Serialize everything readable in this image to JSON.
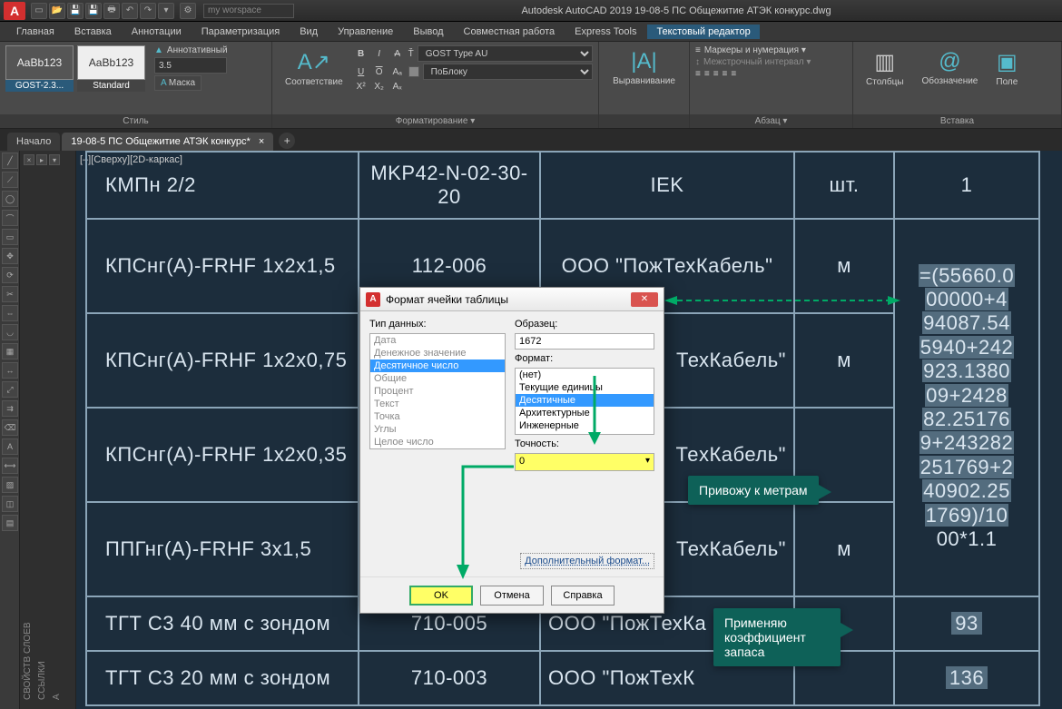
{
  "app": {
    "title": "Autodesk AutoCAD 2019   19-08-5 ПС Общежитие АТЭК конкурс.dwg",
    "search_placeholder": "my worspace"
  },
  "menu": {
    "items": [
      "Главная",
      "Вставка",
      "Аннотации",
      "Параметризация",
      "Вид",
      "Управление",
      "Вывод",
      "Совместная работа",
      "Express Tools",
      "Текстовый редактор"
    ],
    "active": 9
  },
  "ribbon": {
    "style": {
      "swatch1": "AaBb123",
      "swatch1_name": "GOST-2.3...",
      "swatch2": "AaBb123",
      "swatch2_name": "Standard",
      "annotative": "Аннотативный",
      "height": "3.5",
      "mask": "Маска",
      "panel": "Стиль"
    },
    "format": {
      "match": "Соответствие",
      "font": "GOST Type AU",
      "color": "ПоБлоку",
      "panel": "Форматирование ▾"
    },
    "align": {
      "label": "Выравнивание",
      "panel": ""
    },
    "para": {
      "bullets": "Маркеры и нумерация ▾",
      "spacing": "Межстрочный интервал ▾",
      "panel": "Абзац ▾"
    },
    "cols": {
      "label": "Столбцы"
    },
    "symbol": {
      "label": "Обозначение"
    },
    "field": {
      "label": "Поле"
    },
    "insert_panel": "Вставка"
  },
  "doctabs": {
    "start": "Начало",
    "active": "19-08-5 ПС Общежитие АТЭК конкурс*"
  },
  "viewport": {
    "label": "[–][Сверху][2D-каркас]"
  },
  "table": {
    "rows": [
      {
        "c1": "КМПн 2/2",
        "c2": "MKP42-N-02-30-20",
        "c3": "IEK",
        "c4": "шт.",
        "c5": "1"
      },
      {
        "c1": "КПСнг(А)-FRHF 1x2x1,5",
        "c2": "112-006",
        "c3": "ООО \"ПожТехКабель\"",
        "c4": "м",
        "c5": ""
      },
      {
        "c1": "КПСнг(А)-FRHF 1x2x0,75",
        "c2": "",
        "c3": "ТехКабель\"",
        "c4": "м",
        "c5": ""
      },
      {
        "c1": "КПСнг(А)-FRHF 1x2x0,35",
        "c2": "",
        "c3": "ТеxКабель\"",
        "c4": "",
        "c5": ""
      },
      {
        "c1": "ППГнг(А)-FRHF 3x1,5",
        "c2": "",
        "c3": "ТехКабель\"",
        "c4": "м",
        "c5": ""
      },
      {
        "c1": "ТГТ С3 40 мм с зондом",
        "c2": "710-005",
        "c3": "ООО \"ПожТехКа",
        "c4": "",
        "c5": "93"
      },
      {
        "c1": "ТГТ С3 20 мм с зондом",
        "c2": "710-003",
        "c3": "ООО \"ПожТехК",
        "c4": "",
        "c5": "136"
      }
    ],
    "formula": "=(55660.000000+494087.545940+242923.138009+242882.251769+243282251769+240902.251769)/1000*1.1"
  },
  "dialog": {
    "title": "Формат ячейки таблицы",
    "type_label": "Тип данных:",
    "types": [
      "Дата",
      "Денежное значение",
      "Десятичное число",
      "Общие",
      "Процент",
      "Текст",
      "Точка",
      "Углы",
      "Целое число"
    ],
    "type_selected": 2,
    "sample_label": "Образец:",
    "sample_value": "1672",
    "format_label": "Формат:",
    "formats": [
      "(нет)",
      "Текущие единицы",
      "Десятичные",
      "Архитектурные",
      "Инженерные"
    ],
    "format_selected": 2,
    "precision_label": "Точность:",
    "precision_value": "0",
    "extra": "Дополнительный формат...",
    "ok": "OK",
    "cancel": "Отмена",
    "help": "Справка"
  },
  "callouts": {
    "c1": "Привожу к метрам",
    "c2": "Применяю коэффициент запаса"
  },
  "vtabs": {
    "t1": "СВОЙСТВ СЛОЕВ",
    "t2": "ССЫЛКИ",
    "t3": "А"
  }
}
